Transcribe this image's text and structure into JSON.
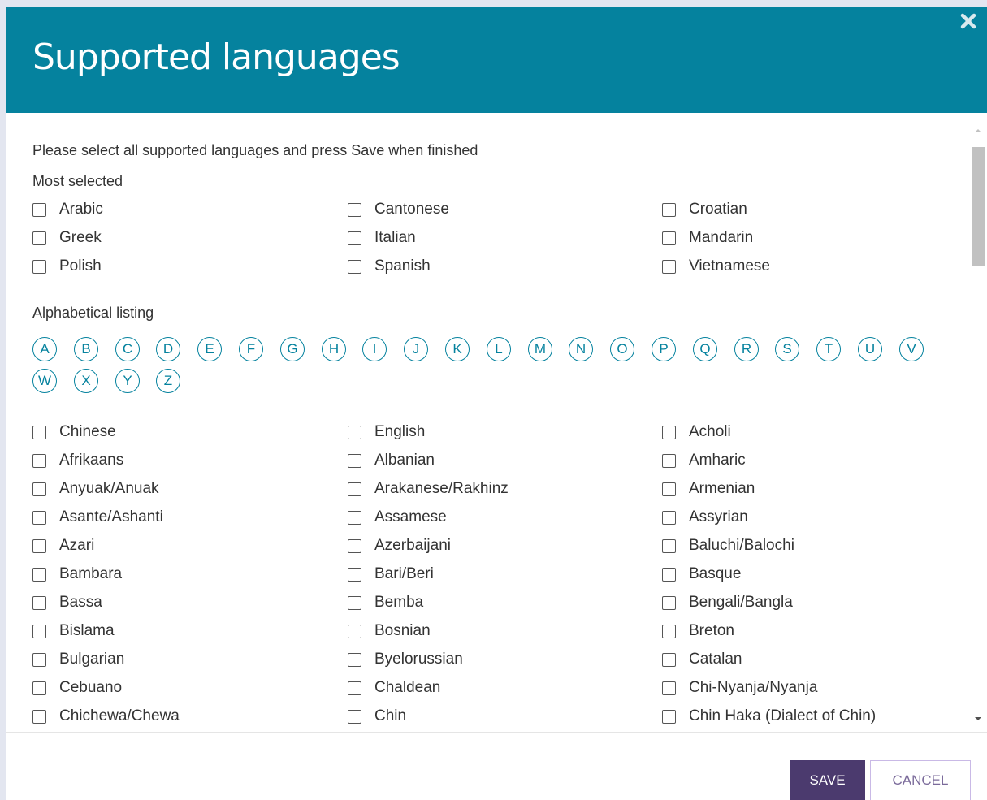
{
  "modal": {
    "title": "Supported languages",
    "close_icon": "close-icon"
  },
  "body": {
    "instruction": "Please select all supported languages and press Save when finished",
    "most_selected_heading": "Most selected",
    "most_selected": [
      "Arabic",
      "Cantonese",
      "Croatian",
      "Greek",
      "Italian",
      "Mandarin",
      "Polish",
      "Spanish",
      "Vietnamese"
    ],
    "alpha_heading": "Alphabetical listing",
    "letters": [
      "A",
      "B",
      "C",
      "D",
      "E",
      "F",
      "G",
      "H",
      "I",
      "J",
      "K",
      "L",
      "M",
      "N",
      "O",
      "P",
      "Q",
      "R",
      "S",
      "T",
      "U",
      "V",
      "W",
      "X",
      "Y",
      "Z"
    ],
    "languages": [
      "Chinese",
      "English",
      "Acholi",
      "Afrikaans",
      "Albanian",
      "Amharic",
      "Anyuak/Anuak",
      "Arakanese/Rakhinz",
      "Armenian",
      "Asante/Ashanti",
      "Assamese",
      "Assyrian",
      "Azari",
      "Azerbaijani",
      "Baluchi/Balochi",
      "Bambara",
      "Bari/Beri",
      "Basque",
      "Bassa",
      "Bemba",
      "Bengali/Bangla",
      "Bislama",
      "Bosnian",
      "Breton",
      "Bulgarian",
      "Byelorussian",
      "Catalan",
      "Cebuano",
      "Chaldean",
      "Chi-Nyanja/Nyanja",
      "Chichewa/Chewa",
      "Chin",
      "Chin Haka (Dialect of Chin)"
    ]
  },
  "footer": {
    "save_label": "SAVE",
    "cancel_label": "CANCEL"
  },
  "colors": {
    "header_bg": "#05829e",
    "save_bg": "#4b3a6e",
    "accent": "#05829e"
  }
}
